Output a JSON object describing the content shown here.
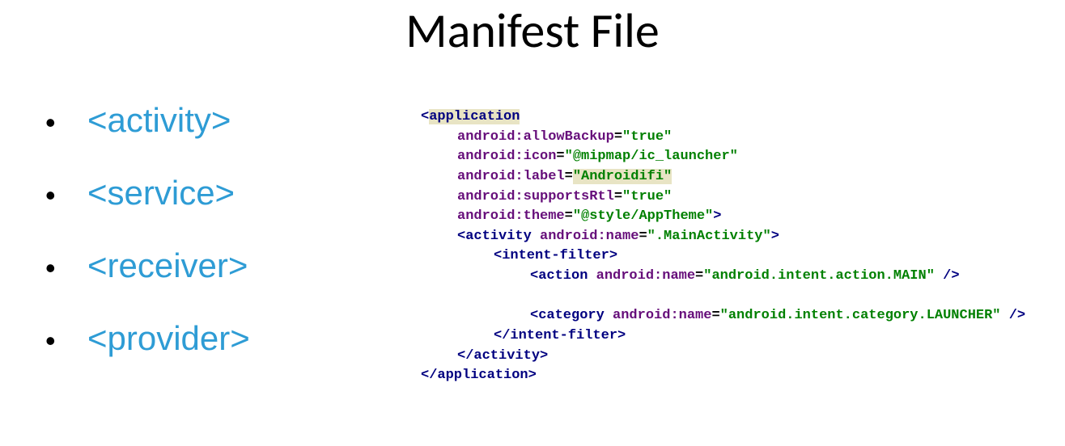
{
  "title": "Manifest File",
  "bullets": {
    "b0": "<activity>",
    "b1": "<service>",
    "b2": "<receiver>",
    "b3": "<provider>"
  },
  "code": {
    "application_open": "application",
    "attrs": {
      "allowBackup": {
        "name": "android:allowBackup",
        "val": "\"true\""
      },
      "icon": {
        "name": "android:icon",
        "val": "\"@mipmap/ic_launcher\""
      },
      "label": {
        "name": "android:label",
        "val": "\"Androidifi\""
      },
      "supportsRtl": {
        "name": "android:supportsRtl",
        "val": "\"true\""
      },
      "theme": {
        "name": "android:theme",
        "val": "\"@style/AppTheme\""
      }
    },
    "activity": {
      "tag": "activity",
      "attr": "android:name",
      "val": "\".MainActivity\""
    },
    "intent_filter": "intent-filter",
    "action": {
      "tag": "action",
      "attr": "android:name",
      "val": "\"android.intent.action.MAIN\""
    },
    "category": {
      "tag": "category",
      "attr": "android:name",
      "val": "\"android.intent.category.LAUNCHER\""
    }
  }
}
